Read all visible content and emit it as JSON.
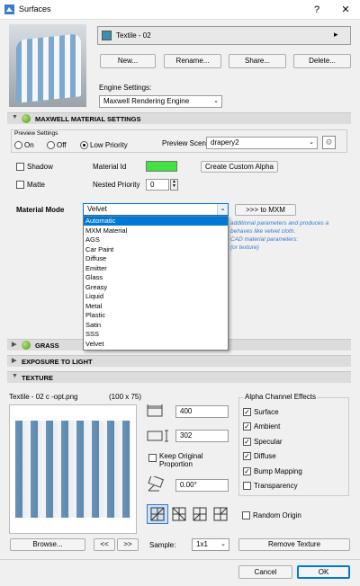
{
  "window": {
    "title": "Surfaces",
    "help": "?",
    "close": "✕"
  },
  "surface": {
    "name": "Textile - 02",
    "swatch_color": "#3a8fb0"
  },
  "buttons": {
    "new": "New...",
    "rename": "Rename...",
    "share": "Share...",
    "delete": "Delete..."
  },
  "engine": {
    "label": "Engine Settings:",
    "value": "Maxwell Rendering Engine"
  },
  "maxwell_section": {
    "title": "MAXWELL MATERIAL SETTINGS"
  },
  "preview": {
    "group_label": "Preview Settings",
    "on": "On",
    "off": "Off",
    "low_priority": "Low Priority",
    "scene_label": "Preview Scene",
    "scene_value": "drapery2"
  },
  "options": {
    "shadow": "Shadow",
    "matte": "Matte",
    "material_id_label": "Material Id",
    "material_id_color": "#44e044",
    "create_alpha": "Create Custom Alpha",
    "nested_priority_label": "Nested Priority",
    "nested_priority_value": "0"
  },
  "material_mode": {
    "label": "Material Mode",
    "value": "Velvet",
    "to_mxm": ">>> to MXM",
    "items": [
      "Automatic",
      "MXM Material",
      "AGS",
      "Car Paint",
      "Diffuse",
      "Emitter",
      "Glass",
      "Greasy",
      "Liquid",
      "Metal",
      "Plastic",
      "Satin",
      "SSS",
      "Velvet"
    ],
    "selected_index": 0,
    "notes": [
      "additional parameters and produces a",
      "behaves like velvet cloth.",
      "CAD material parameters:",
      "(or texture)"
    ]
  },
  "sections": {
    "grass": "GRASS",
    "exposure": "EXPOSURE TO LIGHT",
    "texture": "TEXTURE"
  },
  "texture": {
    "file_name": "Textile - 02 c -opt.png",
    "dimensions": "(100 x 75)",
    "width": "400",
    "height": "302",
    "keep_proportion": "Keep Original Proportion",
    "angle": "0.00°",
    "random_origin": "Random Origin",
    "browse": "Browse...",
    "prev": "<<",
    "next": ">>",
    "sample_label": "Sample:",
    "sample_value": "1x1",
    "remove": "Remove Texture"
  },
  "alpha": {
    "title": "Alpha Channel Effects",
    "items": [
      {
        "label": "Surface",
        "checked": true
      },
      {
        "label": "Ambient",
        "checked": true
      },
      {
        "label": "Specular",
        "checked": true
      },
      {
        "label": "Diffuse",
        "checked": true
      },
      {
        "label": "Bump Mapping",
        "checked": true
      },
      {
        "label": "Transparency",
        "checked": false
      }
    ]
  },
  "footer": {
    "cancel": "Cancel",
    "ok": "OK"
  }
}
